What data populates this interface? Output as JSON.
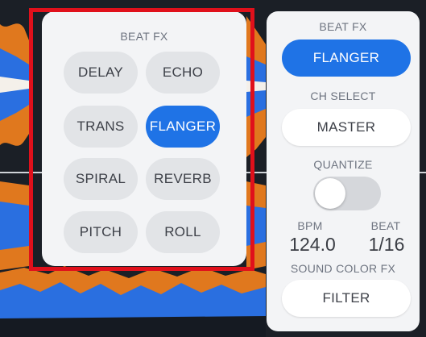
{
  "beat_fx_panel": {
    "title": "BEAT FX",
    "buttons": [
      {
        "label": "DELAY",
        "active": false
      },
      {
        "label": "ECHO",
        "active": false
      },
      {
        "label": "TRANS",
        "active": false
      },
      {
        "label": "FLANGER",
        "active": true
      },
      {
        "label": "SPIRAL",
        "active": false
      },
      {
        "label": "REVERB",
        "active": false
      },
      {
        "label": "PITCH",
        "active": false
      },
      {
        "label": "ROLL",
        "active": false
      }
    ]
  },
  "settings_panel": {
    "beat_fx_label": "BEAT FX",
    "beat_fx_value": "FLANGER",
    "ch_select_label": "CH SELECT",
    "ch_select_value": "MASTER",
    "quantize_label": "QUANTIZE",
    "quantize_on": false,
    "bpm_label": "BPM",
    "bpm_value": "124.0",
    "beat_label": "BEAT",
    "beat_value": "1/16",
    "sound_color_label": "SOUND COLOR FX",
    "sound_color_value": "FILTER"
  },
  "colors": {
    "accent": "#1f73e6",
    "highlight_box": "#e0101b",
    "waveform_orange": "#e0781e",
    "waveform_blue": "#2a6fe0"
  }
}
